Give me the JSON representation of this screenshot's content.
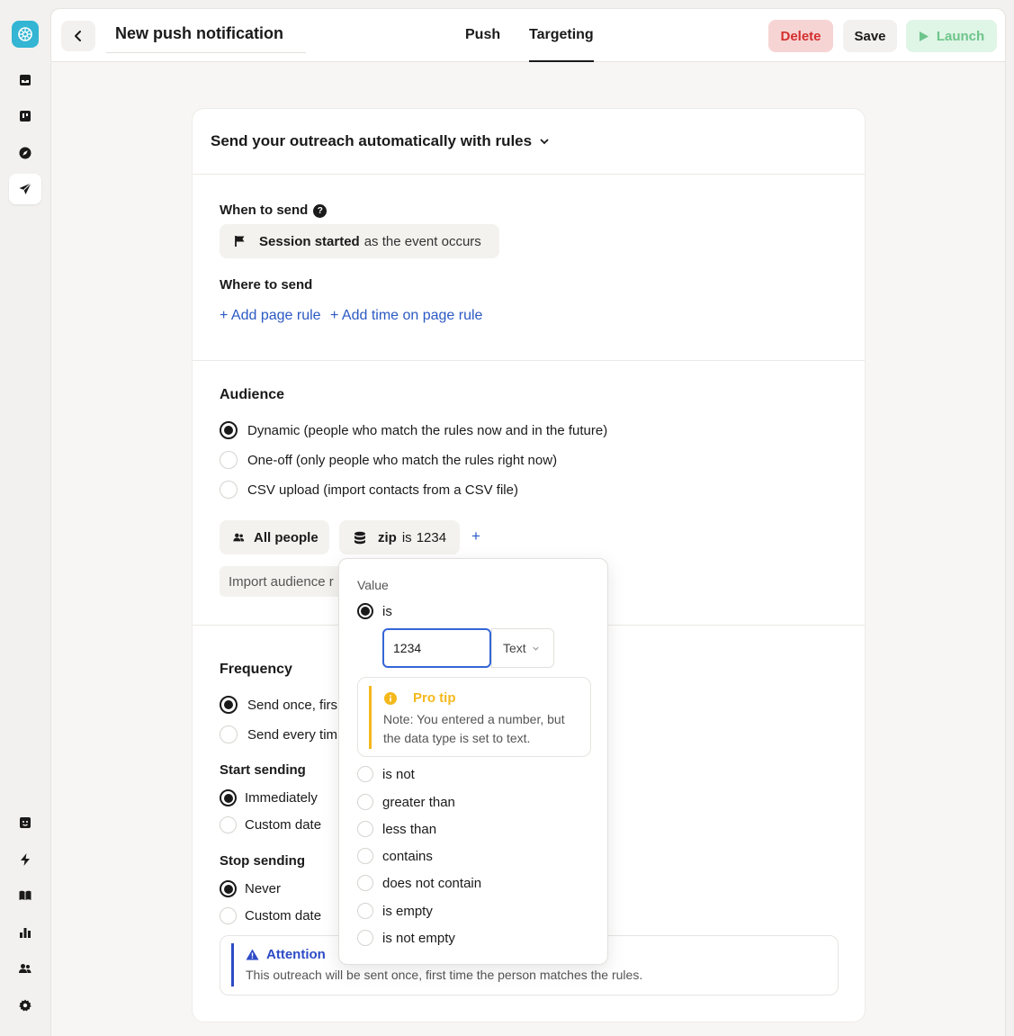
{
  "header": {
    "title": "New push notification",
    "tabs": [
      {
        "label": "Push",
        "active": false
      },
      {
        "label": "Targeting",
        "active": true
      }
    ],
    "delete_label": "Delete",
    "save_label": "Save",
    "launch_label": "Launch"
  },
  "card": {
    "heading": "Send your outreach automatically with rules"
  },
  "when": {
    "label": "When to send",
    "event_name": "Session started",
    "event_suffix": "as the event occurs"
  },
  "where": {
    "label": "Where to send",
    "add_page_rule": "+ Add page rule",
    "add_time_rule": "+ Add time on page rule"
  },
  "audience": {
    "label": "Audience",
    "options": [
      {
        "label": "Dynamic (people who match the rules now and in the future)",
        "selected": true
      },
      {
        "label": "One-off (only people who match the rules right now)",
        "selected": false
      },
      {
        "label": "CSV upload (import contacts from a CSV file)",
        "selected": false
      }
    ],
    "all_people": "All people",
    "rule_attr": "zip",
    "rule_op": "is",
    "rule_value": "1234",
    "add_rule": "+",
    "import_label": "Import audience r"
  },
  "frequency": {
    "label": "Frequency",
    "options": [
      {
        "label": "Send once, firs",
        "selected": true
      },
      {
        "label": "Send every tim",
        "selected": false
      }
    ]
  },
  "start": {
    "label": "Start sending",
    "options": [
      {
        "label": "Immediately",
        "selected": true
      },
      {
        "label": "Custom date",
        "selected": false
      }
    ]
  },
  "stop": {
    "label": "Stop sending",
    "options": [
      {
        "label": "Never",
        "selected": true
      },
      {
        "label": "Custom date",
        "selected": false
      }
    ]
  },
  "attention": {
    "title": "Attention",
    "text": "This outreach will be sent once, first time the person matches the rules."
  },
  "popover": {
    "label": "Value",
    "selected_op": "is",
    "input_value": "1234",
    "type_value": "Text",
    "protip_title": "Pro tip",
    "protip_text": "Note: You entered a number, but the data type is set to text.",
    "other_ops": [
      "is not",
      "greater than",
      "less than",
      "contains",
      "does not contain",
      "is empty",
      "is not empty"
    ]
  },
  "colors": {
    "accent_blue": "#2b59c3",
    "delete_red": "#d42e2e",
    "launch_green": "#6cc58a",
    "protip_yellow": "#f4b81c",
    "logo_teal": "#33b5d3"
  },
  "icons": [
    "logo-icon",
    "inbox-icon",
    "board-icon",
    "compass-icon",
    "send-icon",
    "chat-icon",
    "bolt-icon",
    "book-icon",
    "chart-icon",
    "people-icon",
    "gear-icon"
  ]
}
